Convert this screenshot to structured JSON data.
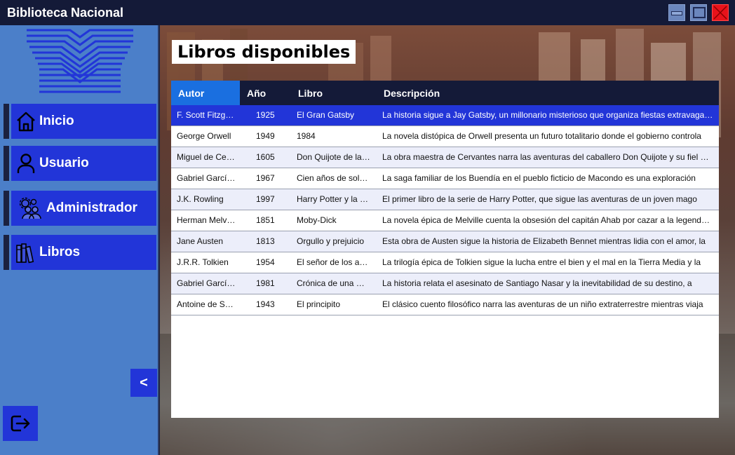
{
  "window": {
    "title": "Biblioteca Nacional"
  },
  "sidebar": {
    "items": [
      {
        "label": "Inicio",
        "icon": "home-icon"
      },
      {
        "label": "Usuario",
        "icon": "user-icon"
      },
      {
        "label": "Administrador",
        "icon": "admin-gears-icon"
      },
      {
        "label": "Libros",
        "icon": "books-icon"
      }
    ],
    "collapse_label": "<",
    "logout_icon": "logout-icon"
  },
  "main": {
    "heading": "Libros disponibles",
    "table": {
      "columns": [
        "Autor",
        "Año",
        "Libro",
        "Descripción"
      ],
      "rows": [
        {
          "autor": "F. Scott Fitzgerald",
          "anio": "1925",
          "libro": "El Gran Gatsby",
          "descripcion": "La historia sigue a Jay Gatsby, un millonario misterioso que organiza fiestas extravagantes"
        },
        {
          "autor": "George Orwell",
          "anio": "1949",
          "libro": "1984",
          "descripcion": "La novela distópica de Orwell presenta un futuro totalitario donde el gobierno controla"
        },
        {
          "autor": "Miguel de Cervantes",
          "anio": "1605",
          "libro": "Don Quijote de la Mancha",
          "descripcion": "La obra maestra de Cervantes narra las aventuras del caballero Don Quijote y su fiel escudero"
        },
        {
          "autor": "Gabriel García Márquez",
          "anio": "1967",
          "libro": "Cien años de soledad",
          "descripcion": "La saga familiar de los Buendía en el pueblo ficticio de Macondo es una exploración"
        },
        {
          "autor": "J.K. Rowling",
          "anio": "1997",
          "libro": "Harry Potter y la piedra filosofal",
          "descripcion": "El primer libro de la serie de Harry Potter, que sigue las aventuras de un joven mago"
        },
        {
          "autor": "Herman Melville",
          "anio": "1851",
          "libro": "Moby-Dick",
          "descripcion": "La novela épica de Melville cuenta la obsesión del capitán Ahab por cazar a la legendaria"
        },
        {
          "autor": "Jane Austen",
          "anio": "1813",
          "libro": "Orgullo y prejuicio",
          "descripcion": "Esta obra de Austen sigue la historia de Elizabeth Bennet mientras lidia con el amor, la"
        },
        {
          "autor": "J.R.R. Tolkien",
          "anio": "1954",
          "libro": "El señor de los anillos",
          "descripcion": "La trilogía épica de Tolkien sigue la lucha entre el bien y el mal en la Tierra Media y la"
        },
        {
          "autor": "Gabriel García Márquez",
          "anio": "1981",
          "libro": "Crónica de una muerte anunciada",
          "descripcion": "La historia relata el asesinato de Santiago Nasar y la inevitabilidad de su destino, a"
        },
        {
          "autor": "Antoine de Saint-Exupéry",
          "anio": "1943",
          "libro": "El principito",
          "descripcion": "El clásico cuento filosófico narra las aventuras de un niño extraterrestre mientras viaja"
        }
      ],
      "selected_row": 0,
      "active_column": "Autor"
    }
  },
  "colors": {
    "titlebar": "#141a38",
    "sidebar": "#4b7fc9",
    "nav_button": "#2235d8",
    "header_active": "#1a6fe0",
    "close": "#e8121a"
  }
}
